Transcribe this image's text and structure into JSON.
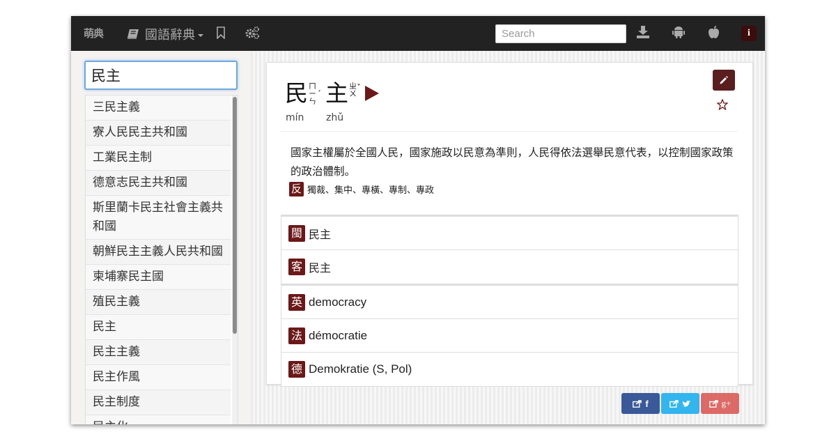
{
  "navbar": {
    "brand": "萌典",
    "dict_label": "國語辭典",
    "search_placeholder": "Search",
    "info_label": "i"
  },
  "sidebar": {
    "query": "民主",
    "results": [
      "三民主義",
      "寮人民民主共和國",
      "工業民主制",
      "德意志民主共和國",
      "斯里蘭卡民主社會主義共和國",
      "朝鮮民主主義人民共和國",
      "柬埔寨民主國",
      "殖民主義",
      "民主",
      "民主主義",
      "民主作風",
      "民主制度",
      "民主化"
    ]
  },
  "entry": {
    "char1": "民",
    "char1_zhuyin": [
      "ㄇ",
      "ㄧ",
      "ㄣ"
    ],
    "char1_tone": "ˊ",
    "char2": "主",
    "char2_zhuyin": [
      "ㄓ",
      "ㄨ"
    ],
    "char2_tone": "ˇ",
    "pinyin1": "mín",
    "pinyin2": "zhǔ",
    "definition": "國家主權屬於全國人民，國家施政以民意為準則，人民得依法選舉民意代表，以控制國家政策的政治體制。",
    "antonym_tag": "反",
    "antonyms": "獨裁、集中、專橫、專制、專政"
  },
  "dialects": [
    {
      "tag": "閩",
      "value": "民主"
    },
    {
      "tag": "客",
      "value": "民主"
    }
  ],
  "translations": [
    {
      "tag": "英",
      "value": "democracy"
    },
    {
      "tag": "法",
      "value": "démocratie"
    },
    {
      "tag": "德",
      "value": "Demokratie (S, Pol)"
    }
  ],
  "share": {
    "facebook": "f",
    "twitter": "",
    "google": "g+"
  },
  "colors": {
    "navbar": "#222222",
    "accent": "#6b1818",
    "facebook": "#3b5998",
    "twitter": "#33b5ee",
    "google": "#d9534f"
  }
}
